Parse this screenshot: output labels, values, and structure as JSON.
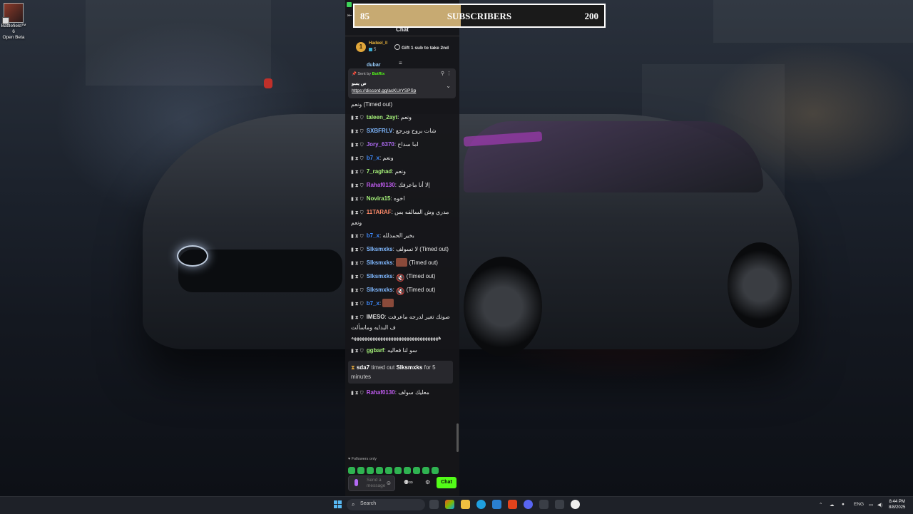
{
  "desktop": {
    "icon_label": "Battlefield™ 6\nOpen Beta"
  },
  "goal": {
    "current": "85",
    "title": "SUBSCRIBERS",
    "target": "200",
    "progress": 0.425
  },
  "chat": {
    "title": "Chat",
    "leaderboard": {
      "rank": "1",
      "username": "Hadeel_ll",
      "count": "5"
    },
    "gift_cta": "Gift 1 sub to take 2nd",
    "peek_text": "dubar",
    "pinned": {
      "sent_by_prefix": "Sent by",
      "sender": "BotRix",
      "text": "ص بسو",
      "link": "https://discord.gg/acKUrYSPSp"
    },
    "messages": [
      {
        "user": "",
        "color": "#e6e6e6",
        "text": "ونعم (Timed out)",
        "badges": false
      },
      {
        "user": "taleen_2ayt",
        "color": "#a6f27a",
        "text": "ونعم",
        "badges": true
      },
      {
        "user": "SXBFRLV",
        "color": "#7fb8ff",
        "text": "شات بروح ويرجع",
        "badges": true
      },
      {
        "user": "Jory_6370",
        "color": "#b06cf5",
        "text": "اما سداح",
        "badges": true
      },
      {
        "user": "b7_x",
        "color": "#3f8cff",
        "text": "ونعم",
        "badges": true
      },
      {
        "user": "7_raghad",
        "color": "#a6f27a",
        "text": "ونعم",
        "badges": true
      },
      {
        "user": "Rahaf0130",
        "color": "#c05cf0",
        "text": "إلا أنا ماعرفك",
        "badges": true
      },
      {
        "user": "Novira15",
        "color": "#a6f27a",
        "text": "اخوه",
        "badges": true
      },
      {
        "user": "11TARAF",
        "color": "#ff8a6a",
        "text": "مدري وش السالفه بس ونعم",
        "badges": true
      },
      {
        "user": "b7_x",
        "color": "#3f8cff",
        "text": "بخير الحمدلله",
        "badges": true
      },
      {
        "user": "Slksmxks",
        "color": "#7fb8ff",
        "text": "لا تسولف (Timed out)",
        "badges": true
      },
      {
        "user": "Slksmxks",
        "color": "#7fb8ff",
        "text": "(Timed out)",
        "badges": true,
        "emote": "img"
      },
      {
        "user": "Slksmxks",
        "color": "#7fb8ff",
        "text": "(Timed out)",
        "badges": true,
        "emote": "mute"
      },
      {
        "user": "Slksmxks",
        "color": "#7fb8ff",
        "text": "(Timed out)",
        "badges": true,
        "emote": "mute"
      },
      {
        "user": "b7_x",
        "color": "#3f8cff",
        "text": "",
        "badges": true,
        "emote": "img"
      },
      {
        "user": "IMESO",
        "color": "#e6e6e6",
        "text": "صوتك تغير لدرجه ماعرفت ف البدايه وماسألت هههههههههههههههههههههههههههههههههه",
        "badges": true
      },
      {
        "user": "ggbarf",
        "color": "#a6f27a",
        "text": "سو لنا فعاليه",
        "badges": true
      }
    ],
    "system_message": {
      "moderator": "sda7",
      "action": "timed out",
      "target": "Slksmxks",
      "duration": "for 5 minutes"
    },
    "last_message": {
      "user": "Rahaf0130",
      "color": "#c05cf0",
      "text": "معليك سولف"
    },
    "followers_only": "Followers only",
    "input_placeholder": "Send a message",
    "send_label": "Chat"
  },
  "taskbar": {
    "search_placeholder": "Search",
    "language": "ENG",
    "time": "8:44 PM",
    "date": "8/8/2025"
  },
  "colors": {
    "goal_fill": "#c7aa72",
    "kick_green": "#53fc18"
  }
}
